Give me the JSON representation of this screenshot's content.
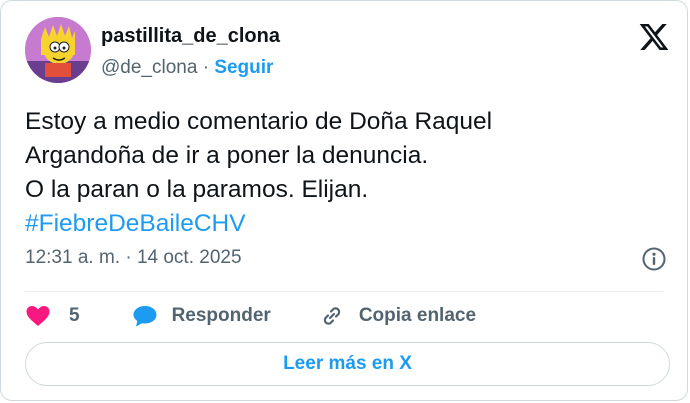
{
  "user": {
    "display_name": "pastillita_de_clona",
    "handle": "@de_clona",
    "separator": "·",
    "follow_label": "Seguir"
  },
  "brand_logo": "x-logo-icon",
  "tweet": {
    "lines": [
      "Estoy a medio comentario de Doña Raquel",
      "Argandoña de ir a poner la denuncia.",
      "O la paran o la paramos. Elijan."
    ],
    "hashtag": "#FiebreDeBaileCHV"
  },
  "meta": {
    "time": "12:31 a. m.",
    "separator": "·",
    "date": "14 oct. 2025"
  },
  "actions": {
    "like_count": "5",
    "reply_label": "Responder",
    "copy_label": "Copia enlace"
  },
  "read_more_label": "Leer más en X",
  "colors": {
    "accent": "#1d9bf0",
    "like": "#f91880",
    "secondary_text": "#536471",
    "border": "#cfd9de"
  }
}
